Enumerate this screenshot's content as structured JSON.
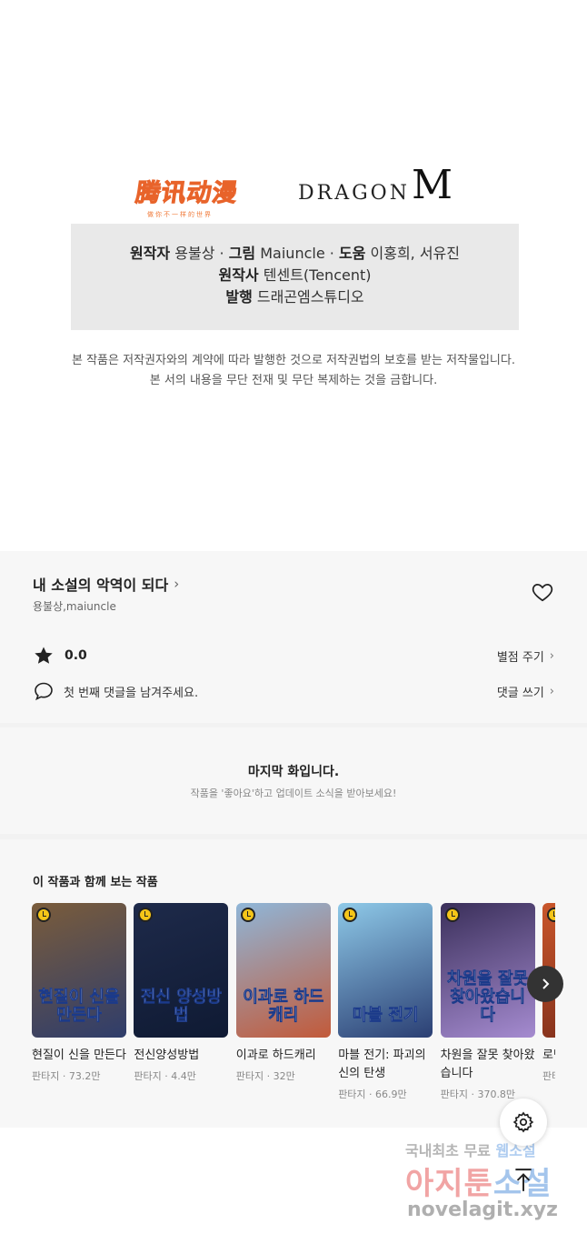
{
  "logos": {
    "tencent_mark": "腾讯动漫",
    "tencent_sub": "做你不一样的世界",
    "dragon_word": "DRAGON",
    "dragon_big": "M"
  },
  "credits": {
    "line1": [
      {
        "label": "원작자",
        "value": "용불상"
      },
      {
        "label": "그림",
        "value": "Maiuncle"
      },
      {
        "label": "도움",
        "value": "이홍희, 서유진"
      }
    ],
    "line2": {
      "label": "원작사",
      "value": "텐센트(Tencent)"
    },
    "line3": {
      "label": "발행",
      "value": "드래곤엠스튜디오"
    },
    "separator": "·"
  },
  "copyright": {
    "line1": "본 작품은 저작권자와의 계약에 따라 발행한 것으로 저작권법의 보호를 받는 저작물입니다.",
    "line2": "본 서의 내용을 무단 전재 및 무단 복제하는 것을 금합니다."
  },
  "work": {
    "title": "내 소설의 악역이 되다",
    "authors": "용불상,maiuncle",
    "rating": "0.0",
    "rate_link": "별점 주기",
    "comment_prompt": "첫 번째 댓글을 남겨주세요.",
    "comment_link": "댓글 쓰기",
    "chevron": "›"
  },
  "last": {
    "title": "마지막 화입니다.",
    "subtitle": "작품을 '좋아요'하고 업데이트 소식을 받아보세요!"
  },
  "recommendations": {
    "title": "이 작품과 함께 보는 작품",
    "items": [
      {
        "name": "현질이 신을 만든다",
        "meta": "판타지 · 73.2만",
        "cover_text": "현질이 신을 만든다",
        "color_top": "#7a5c3b",
        "color_bottom": "#2f3d6b"
      },
      {
        "name": "전신양성방법",
        "meta": "판타지 · 4.4만",
        "cover_text": "전신 양성방법",
        "color_top": "#1e2a4a",
        "color_bottom": "#0f1a33"
      },
      {
        "name": "이과로 하드캐리",
        "meta": "판타지 · 32만",
        "cover_text": "이과로 하드캐리",
        "color_top": "#8fb6d8",
        "color_bottom": "#c25a3a"
      },
      {
        "name": "마블 전기: 파괴의 신의 탄생",
        "meta": "판타지 · 66.9만",
        "cover_text": "마블 전기",
        "color_top": "#8ec9e8",
        "color_bottom": "#2b3f73"
      },
      {
        "name": "차원을 잘못 찾아왔습니다",
        "meta": "판타지 · 370.8만",
        "cover_text": "차원을 잘못 찾아왔습니다",
        "color_top": "#3a2f5a",
        "color_bottom": "#a58bd0"
      },
      {
        "name": "로맨스 판타지 승",
        "meta": "판타지",
        "cover_text": "",
        "color_top": "#c9562b",
        "color_bottom": "#7a2c1a"
      }
    ]
  },
  "watermark": {
    "line1_a": "국내최초 무료 ",
    "line1_b": "웹소설",
    "line2_a": "아지툰",
    "line2_b": "소설",
    "line3": "novelagit.xyz"
  },
  "colors": {
    "section_bg": "#f7f7f7",
    "credit_bg": "#e9e9e9",
    "accent_orange": "#f5843a"
  }
}
